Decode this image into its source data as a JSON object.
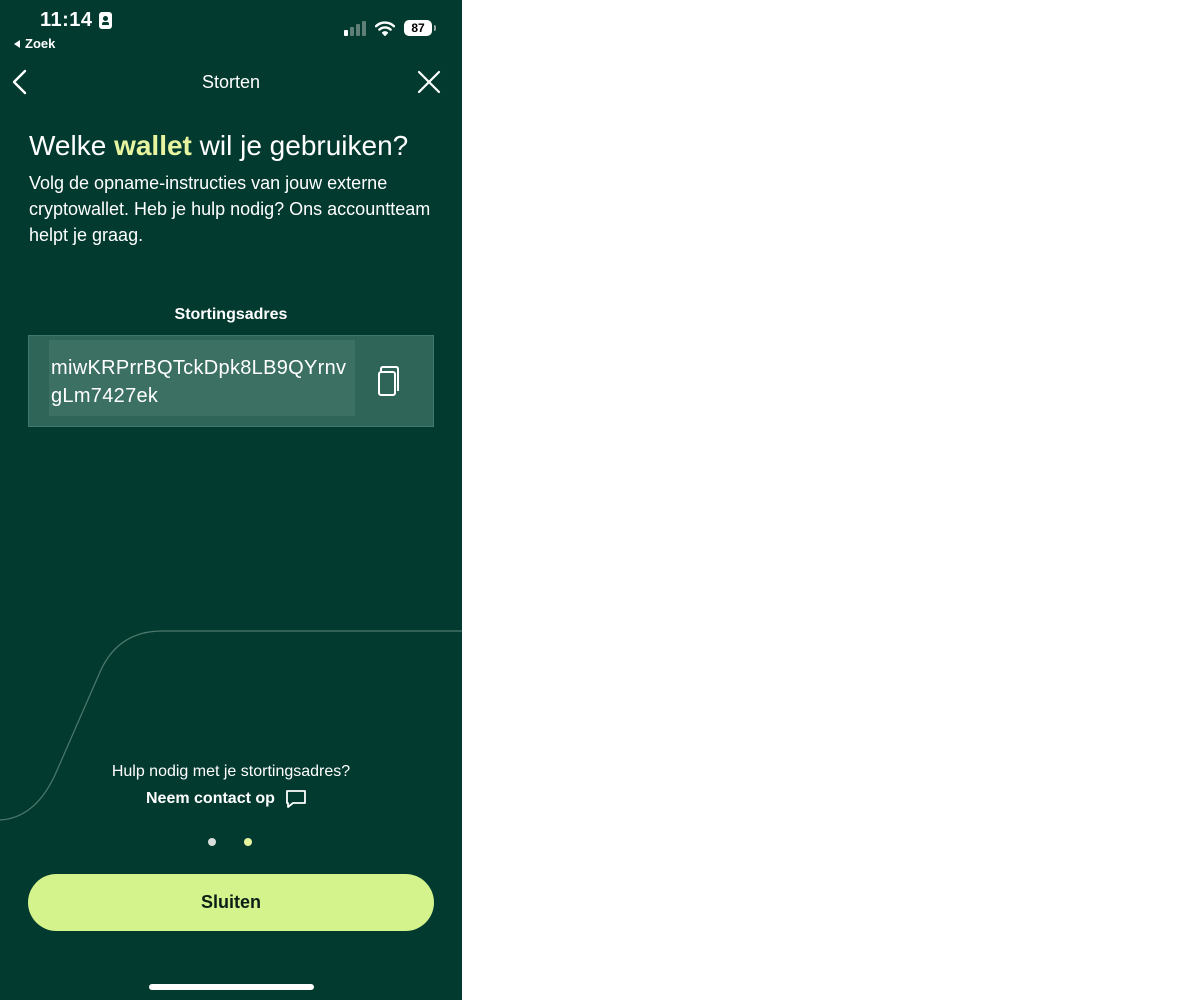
{
  "status_bar": {
    "time": "11:14",
    "back_app_label": "Zoek",
    "battery_level": "87",
    "signal_bars_active": 1,
    "signal_bars_total": 4
  },
  "nav": {
    "title": "Storten",
    "back_icon": "chevron-left-icon",
    "close_icon": "close-icon"
  },
  "main": {
    "heading_before": "Welke",
    "heading_highlight": "wallet",
    "heading_after": "wil je gebruiken?",
    "description": "Volg de opname-instructies van jouw externe cryptowallet. Heb je hulp nodig? Ons accountteam helpt je graag.",
    "address_label": "Stortingsadres",
    "address": "miwKRPrrBQTckDpk8LB9QYrnvgLm7427ek",
    "copy_icon": "copy-icon"
  },
  "help": {
    "question": "Hulp nodig met je stortingsadres?",
    "contact_label": "Neem contact op",
    "contact_icon": "chat-bubble-icon"
  },
  "pagination": {
    "total": 2,
    "active": 2
  },
  "footer": {
    "close_label": "Sluiten"
  },
  "colors": {
    "background": "#033a2f",
    "accent": "#d4f38c",
    "highlight": "#e8f5a0",
    "address_box": "#2f6559"
  }
}
